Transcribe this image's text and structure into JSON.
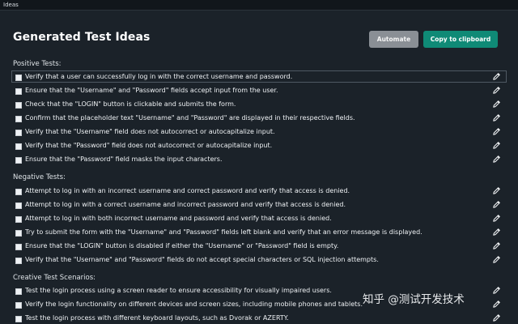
{
  "window": {
    "title": "Ideas"
  },
  "header": {
    "title": "Generated Test Ideas",
    "automate_label": "Automate",
    "copy_label": "Copy to clipboard"
  },
  "sections": {
    "positive": {
      "label": "Positive Tests:",
      "items": [
        "Verify that a user can successfully log in with the correct username and password.",
        "Ensure that the \"Username\" and \"Password\" fields accept input from the user.",
        "Check that the \"LOGIN\" button is clickable and submits the form.",
        "Confirm that the placeholder text \"Username\" and \"Password\" are displayed in their respective fields.",
        "Verify that the \"Username\" field does not autocorrect or autocapitalize input.",
        "Verify that the \"Password\" field does not autocorrect or autocapitalize input.",
        "Ensure that the \"Password\" field masks the input characters."
      ]
    },
    "negative": {
      "label": "Negative Tests:",
      "items": [
        "Attempt to log in with an incorrect username and correct password and verify that access is denied.",
        "Attempt to log in with a correct username and incorrect password and verify that access is denied.",
        "Attempt to log in with both incorrect username and password and verify that access is denied.",
        "Try to submit the form with the \"Username\" and \"Password\" fields left blank and verify that an error message is displayed.",
        "Ensure that the \"LOGIN\" button is disabled if either the \"Username\" or \"Password\" field is empty.",
        "Verify that the \"Username\" and \"Password\" fields do not accept special characters or SQL injection attempts."
      ]
    },
    "creative": {
      "label": "Creative Test Scenarios:",
      "items": [
        "Test the login process using a screen reader to ensure accessibility for visually impaired users.",
        "Verify the login functionality on different devices and screen sizes, including mobile phones and tablets.",
        "Test the login process with different keyboard layouts, such as Dvorak or AZERTY."
      ]
    }
  },
  "watermark": {
    "text": "知乎 @测试开发技术"
  },
  "icons": {
    "row_edit": "pencil-icon",
    "row_check": "checkbox"
  },
  "colors": {
    "background": "#1b2229",
    "accent": "#0f8a76",
    "secondary_button": "#8a8f95"
  }
}
